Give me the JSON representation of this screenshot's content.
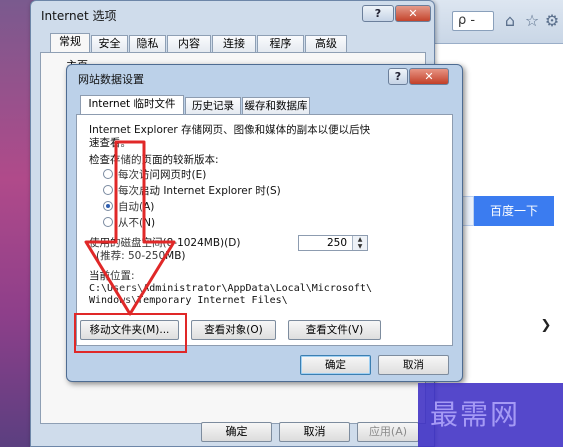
{
  "internet_options": {
    "title": "Internet 选项",
    "tabs": [
      "常规",
      "安全",
      "隐私",
      "内容",
      "连接",
      "程序",
      "高级"
    ],
    "home_fragment": "主页",
    "buttons": {
      "ok": "确定",
      "cancel": "取消",
      "apply": "应用(A)"
    }
  },
  "browser": {
    "search_glyph": "ρ -",
    "baidu_button": "百度一下"
  },
  "website_data_settings": {
    "title": "网站数据设置",
    "tabs": [
      "Internet 临时文件",
      "历史记录",
      "缓存和数据库"
    ],
    "description_line1": "Internet Explorer 存储网页、图像和媒体的副本以便以后快",
    "description_line2": "速查看。",
    "check_label": "检查存储的页面的较新版本:",
    "radios": [
      {
        "label": "每次访问网页时(E)",
        "selected": false
      },
      {
        "label": "每次启动 Internet Explorer 时(S)",
        "selected": false
      },
      {
        "label": "自动(A)",
        "selected": true
      },
      {
        "label": "从不(N)",
        "selected": false
      }
    ],
    "disk_label": "使用的磁盘空间(8-1024MB)(D)",
    "disk_recommend": "(推荐: 50-250MB)",
    "disk_value": "250",
    "current_location_label": "当前位置:",
    "current_location_line1": "C:\\Users\\Administrator\\AppData\\Local\\Microsoft\\",
    "current_location_line2": "Windows\\Temporary Internet Files\\",
    "buttons": {
      "move_folder": "移动文件夹(M)...",
      "view_objects": "查看对象(O)",
      "view_files": "查看文件(V)",
      "ok": "确定",
      "cancel": "取消"
    }
  },
  "watermark": "最需网",
  "colors": {
    "annotation_red": "#e02828",
    "dialog_frame": "#bcd1e9",
    "baidu_blue": "#3b7cf0"
  }
}
